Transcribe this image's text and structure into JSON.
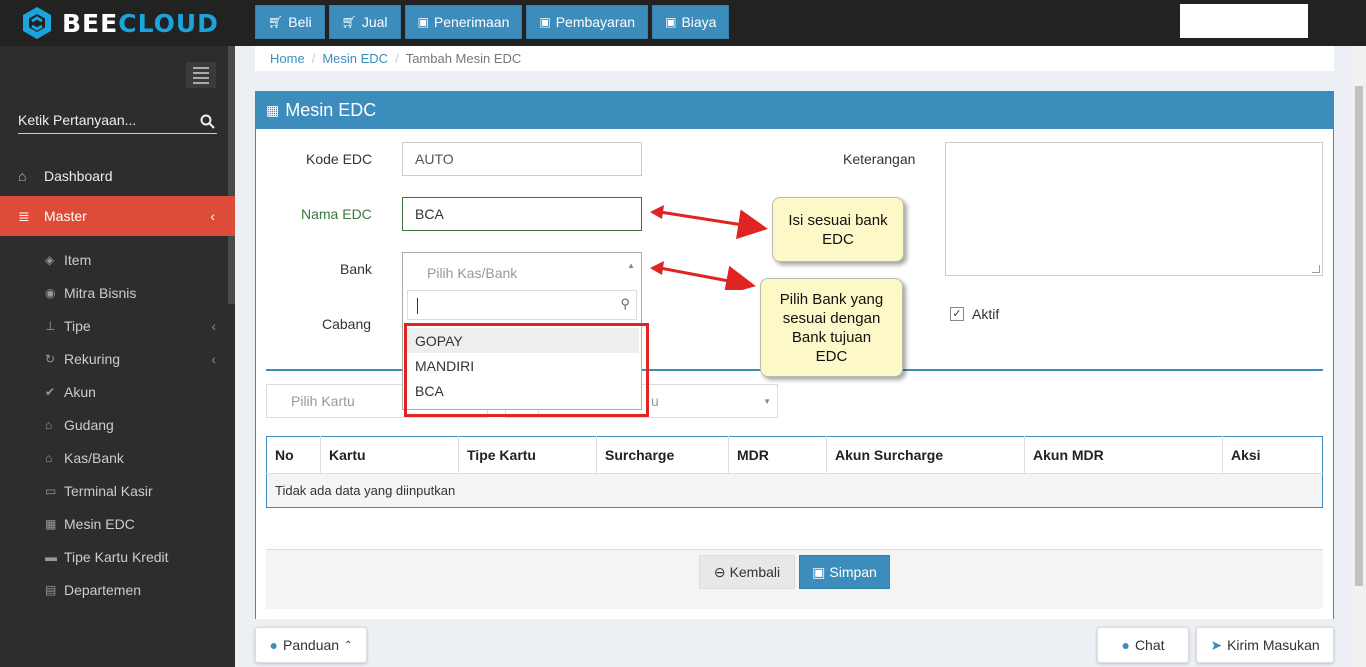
{
  "brand": {
    "part1": "BEE",
    "part2": "CLOUD"
  },
  "topnav": [
    {
      "label": "Beli",
      "icon": "cart-icon"
    },
    {
      "label": "Jual",
      "icon": "cart-icon"
    },
    {
      "label": "Penerimaan",
      "icon": "money-icon"
    },
    {
      "label": "Pembayaran",
      "icon": "money-icon"
    },
    {
      "label": "Biaya",
      "icon": "money-icon"
    }
  ],
  "sidebar": {
    "search_placeholder": "Ketik Pertanyaan...",
    "dashboard": "Dashboard",
    "master": "Master",
    "items": [
      "Item",
      "Mitra Bisnis",
      "Tipe",
      "Rekuring",
      "Akun",
      "Gudang",
      "Kas/Bank",
      "Terminal Kasir",
      "Mesin EDC",
      "Tipe Kartu Kredit",
      "Departemen"
    ]
  },
  "breadcrumb": {
    "home": "Home",
    "parent": "Mesin EDC",
    "current": "Tambah Mesin EDC"
  },
  "panel": {
    "title": "Mesin EDC"
  },
  "form": {
    "kode_label": "Kode EDC",
    "kode_value": "AUTO",
    "nama_label": "Nama EDC",
    "nama_value": "BCA",
    "bank_label": "Bank",
    "bank_placeholder": "Pilih Kas/Bank",
    "cabang_label": "Cabang",
    "keterangan_label": "Keterangan",
    "aktif_label": "Aktif",
    "aktif_checked": true
  },
  "dropdown_options": [
    "GOPAY",
    "MANDIRI",
    "BCA"
  ],
  "callouts": {
    "nama": "Isi sesuai bank EDC",
    "bank": "Pilih Bank yang sesuai dengan Bank tujuan EDC"
  },
  "card_row": {
    "pilih_kartu": "Pilih Kartu",
    "partial_right": "u"
  },
  "table": {
    "headers": [
      "No",
      "Kartu",
      "Tipe Kartu",
      "Surcharge",
      "MDR",
      "Akun Surcharge",
      "Akun MDR",
      "Aksi"
    ],
    "empty_text": "Tidak ada data yang diinputkan"
  },
  "actions": {
    "back": "Kembali",
    "save": "Simpan"
  },
  "floating": {
    "guide": "Panduan",
    "chat": "Chat",
    "feedback": "Kirim Masukan"
  },
  "colors": {
    "primary": "#3c8dbc",
    "danger": "#dd4b39",
    "callout": "#fdf8c7",
    "arrow": "#e02424"
  }
}
